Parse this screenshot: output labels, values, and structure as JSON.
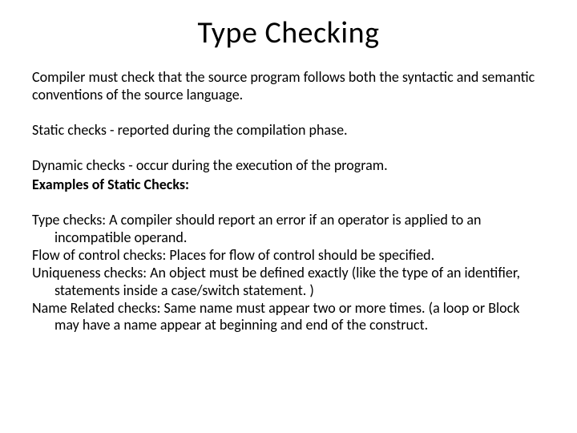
{
  "title": "Type Checking",
  "intro": "Compiler must check that the source program follows both the syntactic and semantic conventions of the source language.",
  "static_line": "Static checks - reported during the compilation phase.",
  "dynamic_line": "Dynamic checks - occur during the execution of the program.",
  "examples_heading": "Examples of Static Checks:",
  "items": [
    "Type checks: A compiler should report an error if an operator is applied to an incompatible operand.",
    "Flow of control checks: Places for flow of  control should be specified.",
    "Uniqueness checks: An object must be defined exactly (like the type of an identifier, statements inside a case/switch statement. )",
    "Name Related checks: Same name must appear two or more times. (a loop or Block may have a name appear at beginning and end of  the construct."
  ]
}
